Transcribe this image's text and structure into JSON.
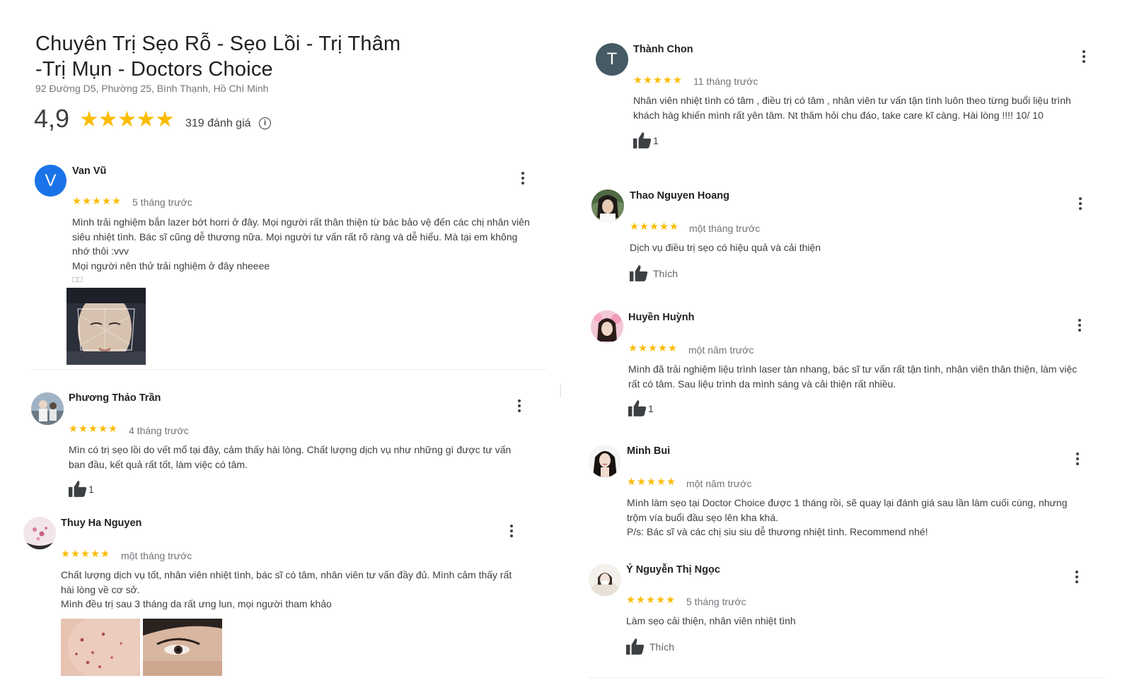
{
  "business": {
    "title_line1": "Chuyên Trị Sẹo Rỗ - Sẹo Lồi - Trị Thâm",
    "title_line2": "-Trị Mụn - Doctors Choice",
    "address": "92 Đường D5, Phường 25, Bình Thạnh, Hồ Chí Minh",
    "rating": "4,9",
    "stars": "★★★★★",
    "review_count": "319 đánh giá",
    "info_icon": "i"
  },
  "colors": {
    "star": "#fbbc04",
    "text": "#3c4043",
    "muted": "#70757a",
    "avatar_v": "#1a73e8",
    "avatar_t": "#455a64"
  },
  "reviews": [
    {
      "name": "Van Vũ",
      "initial": "V",
      "stars": "★★★★★",
      "time": "5 tháng trước",
      "lines": [
        "Mình trải nghiệm bắn lazer bớt horri ở đây. Mọi người rất thân thiện từ bác bảo vệ đến các chị nhân viên",
        "siêu nhiệt tình. Bác sĩ cũng dễ thương nữa. Mọi người tư vấn rất rõ ràng và dễ hiểu. Mà tại em không",
        "nhớ thôi :vvv",
        "Mọi người nên thử trải nghiệm ở đây nheeee",
        "□□"
      ]
    },
    {
      "name": "Phương Thảo Trần",
      "stars": "★★★★★",
      "time": "4 tháng trước",
      "lines": [
        "Mìn có trị sẹo lồi do vết mổ tại đây, cảm thấy hài lòng. Chất lượng dịch vụ như những gì được tư vấn",
        "ban đầu, kết quả rất tốt, làm việc có tâm."
      ],
      "likes": "1"
    },
    {
      "name": "Thuy Ha Nguyen",
      "stars": "★★★★★",
      "time": "một tháng trước",
      "lines": [
        "Chất lượng dịch vụ tốt, nhân viên nhiệt tình, bác sĩ có tâm, nhân viên tư vấn đầy đủ. Mình cảm thấy rất",
        "hài lòng về cơ sở.",
        "Mình đều trị sau 3 tháng da rất ưng lun, mọi người tham khảo"
      ]
    },
    {
      "name": "Thành Chon",
      "initial": "T",
      "stars": "★★★★★",
      "time": "11 tháng trước",
      "lines": [
        "Nhân viên nhiệt tình có tâm , điều trị có tâm , nhân viên tư vấn tận tình luôn theo từng buổi liệu trình",
        "khách hàg khiến mình rất yên tâm. Nt thăm hỏi chu đáo, take care kĩ càng. Hài lòng !!!! 10/ 10"
      ],
      "likes": "1"
    },
    {
      "name": "Thao Nguyen Hoang",
      "stars": "★★★★★",
      "time": "một tháng trước",
      "lines": [
        "Dịch vụ điều trị sẹo có hiệu quả và cải thiện"
      ],
      "likes": "Thích"
    },
    {
      "name": "Huyền Huỳnh",
      "stars": "★★★★★",
      "time": "một năm trước",
      "lines": [
        "Mình đã trải nghiệm liệu trình laser tàn nhang, bác sĩ tư vấn rất tận tình, nhân viên thân thiện, làm việc",
        "rất có tâm. Sau liệu trình da mình sáng và cải thiện rất nhiều."
      ],
      "likes": "1"
    },
    {
      "name": "Minh Bui",
      "stars": "★★★★★",
      "time": "một năm trước",
      "lines": [
        "Mình làm sẹo tại Doctor Choice được 1 tháng rồi, sẽ quay lại đánh giá sau lần làm cuối cùng, nhưng",
        "trộm vía buổi đầu sẹo lên kha khá.",
        "P/s: Bác sĩ và các chị siu siu dễ thương nhiệt tình. Recommend nhé!"
      ]
    },
    {
      "name": "Ý Nguyễn Thị Ngọc",
      "stars": "★★★★★",
      "time": "5 tháng trước",
      "lines": [
        "Làm sẹo cải thiện, nhân viên nhiệt tình"
      ],
      "likes": "Thích"
    }
  ]
}
